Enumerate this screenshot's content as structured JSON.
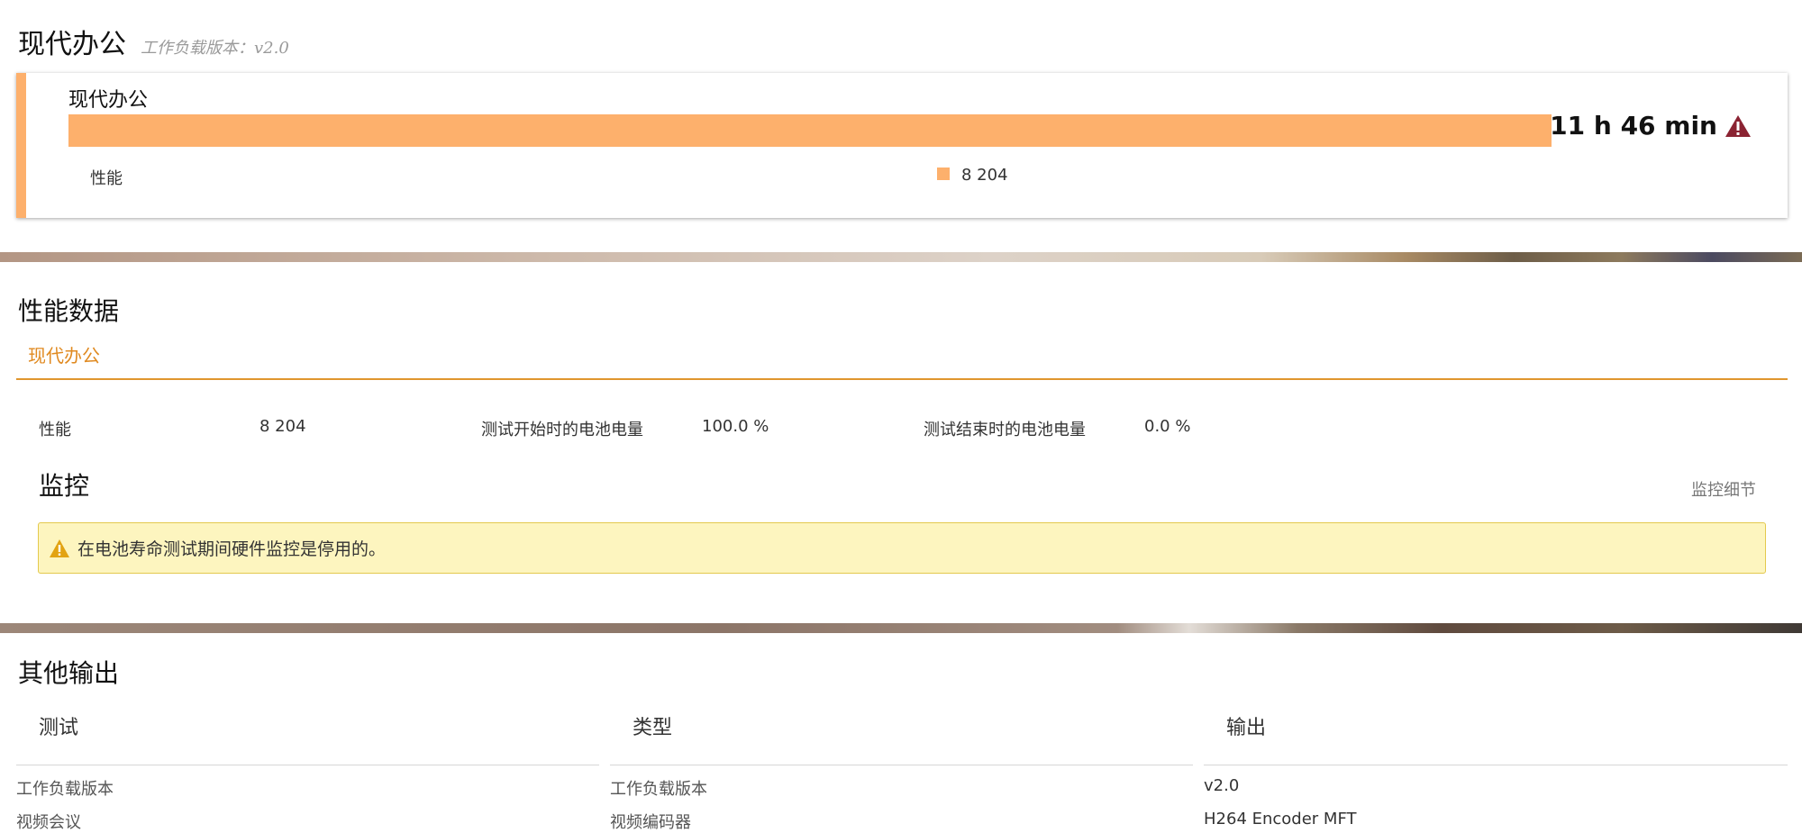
{
  "header": {
    "title": "现代办公",
    "subtitle": "工作负载版本：v2.0"
  },
  "result_card": {
    "title": "现代办公",
    "time": "11 h 46 min",
    "legend_label": "性能",
    "legend_value": "8 204",
    "bar_fill_fraction": 1.0,
    "colors": {
      "accent": "#fdb06c",
      "warning": "#8b2332"
    },
    "icons": {
      "warning": "warning-triangle-icon"
    }
  },
  "performance": {
    "title": "性能数据",
    "active_tab": "现代办公",
    "stats": [
      {
        "label": "性能",
        "value": "8 204"
      },
      {
        "label": "测试开始时的电池电量",
        "value": "100.0 %"
      },
      {
        "label": "测试结束时的电池电量",
        "value": "0.0 %"
      }
    ]
  },
  "monitoring": {
    "title": "监控",
    "details_link": "监控细节",
    "alert": "在电池寿命测试期间硬件监控是停用的。",
    "colors": {
      "alert_bg": "#fdf5bf",
      "alert_icon": "#e2a312"
    }
  },
  "other_outputs": {
    "title": "其他输出",
    "columns": [
      "测试",
      "类型",
      "输出"
    ],
    "rows": [
      [
        "工作负载版本",
        "工作负载版本",
        "v2.0"
      ],
      [
        "视频会议",
        "视频编码器",
        "H264 Encoder MFT"
      ]
    ]
  }
}
